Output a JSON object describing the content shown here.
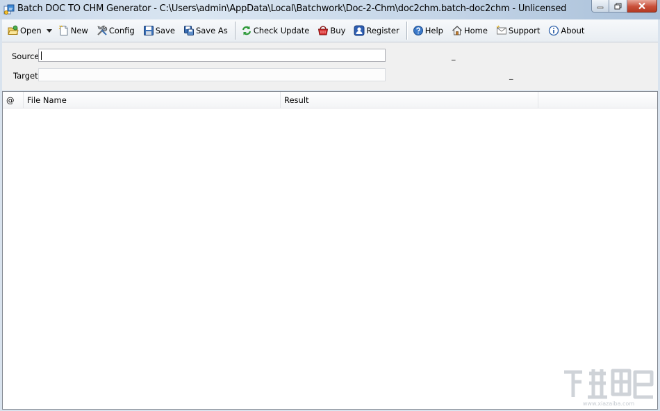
{
  "window": {
    "title": "Batch DOC TO CHM Generator - C:\\Users\\admin\\AppData\\Local\\Batchwork\\Doc-2-Chm\\doc2chm.batch-doc2chm - Unlicensed"
  },
  "toolbar": {
    "open": "Open",
    "new": "New",
    "config": "Config",
    "save": "Save",
    "save_as": "Save As",
    "check_update": "Check Update",
    "buy": "Buy",
    "register": "Register",
    "help": "Help",
    "home": "Home",
    "support": "Support",
    "about": "About"
  },
  "form": {
    "source_label": "Source",
    "source_value": "",
    "target_label": "Target",
    "target_value": "",
    "source_hint": "_",
    "target_hint": "_"
  },
  "list": {
    "columns": [
      "@",
      "File Name",
      "Result",
      ""
    ],
    "rows": []
  },
  "watermark": {
    "text": "www.xiazaiba.com"
  }
}
